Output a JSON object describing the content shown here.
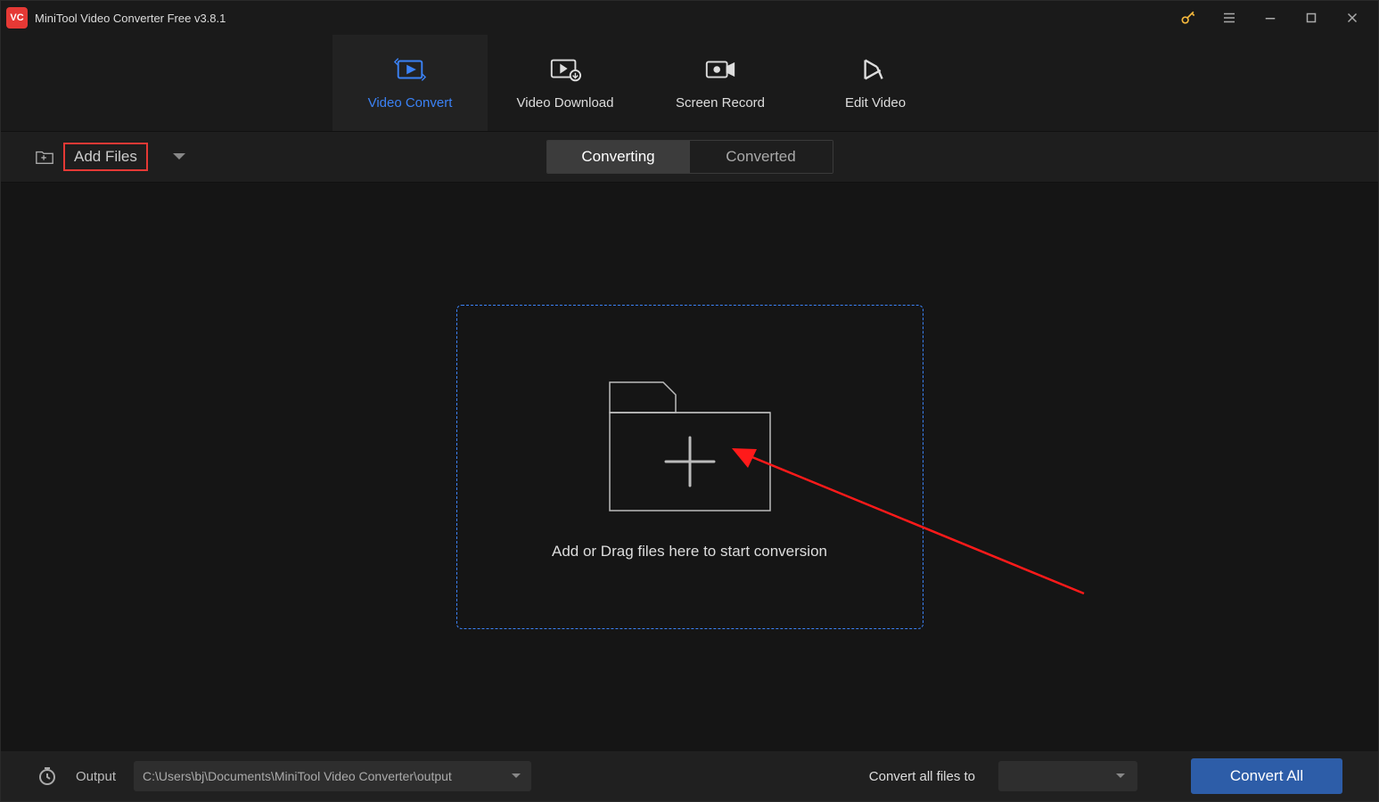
{
  "titlebar": {
    "app_title": "MiniTool Video Converter Free v3.8.1",
    "logo_text": "VC"
  },
  "nav": {
    "tabs": [
      {
        "label": "Video Convert",
        "active": true
      },
      {
        "label": "Video Download",
        "active": false
      },
      {
        "label": "Screen Record",
        "active": false
      },
      {
        "label": "Edit Video",
        "active": false
      }
    ]
  },
  "toolbar": {
    "add_files_label": "Add Files",
    "mode_tabs": {
      "converting": "Converting",
      "converted": "Converted"
    }
  },
  "dropzone": {
    "text": "Add or Drag files here to start conversion"
  },
  "bottom": {
    "output_label": "Output",
    "output_path": "C:\\Users\\bj\\Documents\\MiniTool Video Converter\\output",
    "convert_all_label": "Convert all files to",
    "convert_all_button": "Convert All"
  },
  "annotations": {
    "add_files_highlight": true,
    "dropzone_arrow": true
  }
}
